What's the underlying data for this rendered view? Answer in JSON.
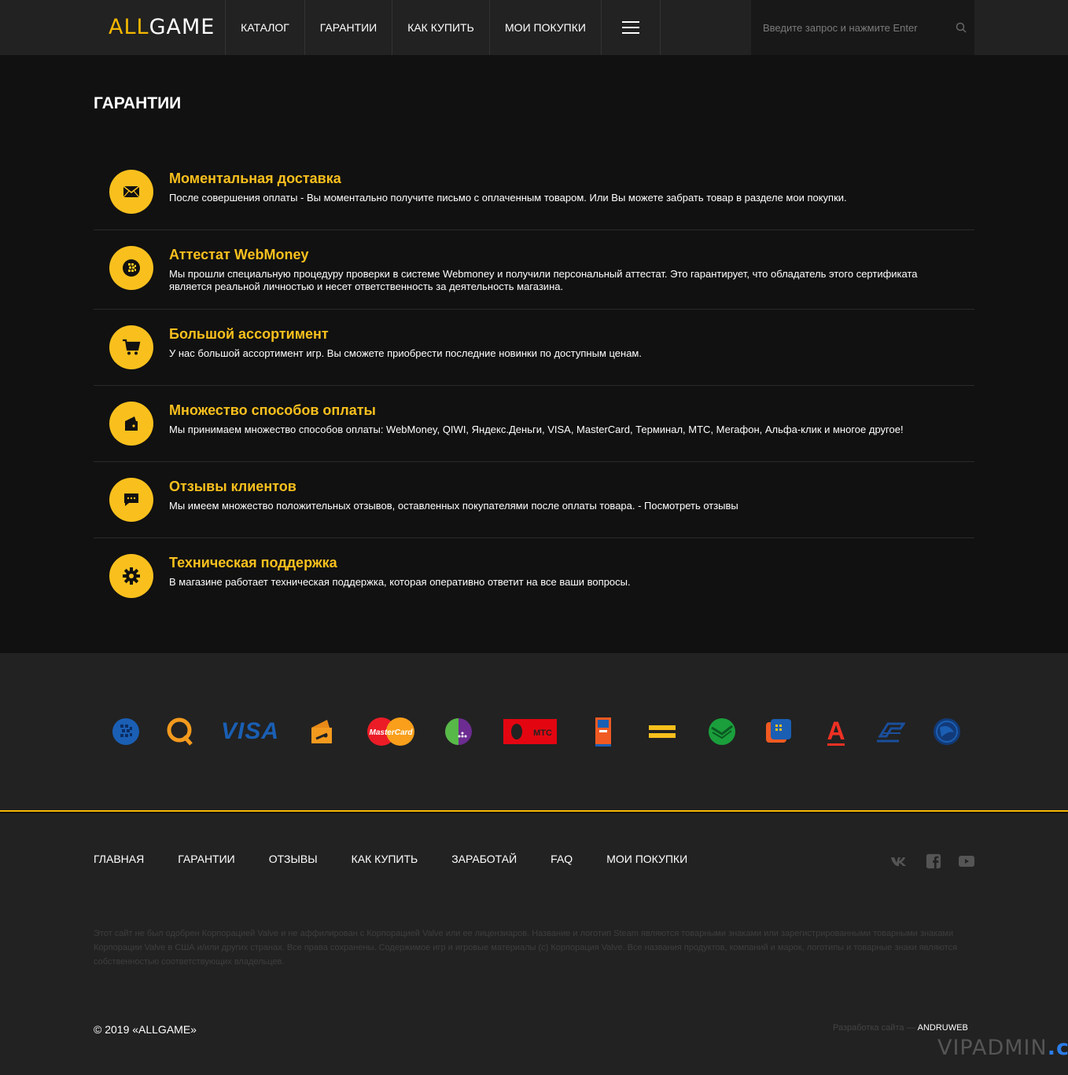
{
  "header": {
    "logo_part1": "ALL",
    "logo_part2": "GAME",
    "nav": [
      "КАТАЛОГ",
      "ГАРАНТИИ",
      "КАК КУПИТЬ",
      "МОИ ПОКУПКИ"
    ],
    "search_placeholder": "Введите запрос и нажмите Enter"
  },
  "main": {
    "title": "ГАРАНТИИ",
    "features": [
      {
        "icon": "envelope-icon",
        "title": "Моментальная доставка",
        "text": "После совершения оплаты - Вы моментально получите письмо с оплаченным товаром. Или Вы можете забрать товар в разделе мои покупки."
      },
      {
        "icon": "webmoney-globe-icon",
        "title": "Аттестат WebMoney",
        "text": "Мы прошли специальную процедуру проверки в системе Webmoney и получили персональный аттестат. Это гарантирует, что обладатель этого сертификата является реальной личностью и несет ответственность за деятельность магазина."
      },
      {
        "icon": "cart-icon",
        "title": "Большой ассортимент",
        "text": "У нас большой ассортимент игр. Вы сможете приобрести последние новинки по доступным ценам."
      },
      {
        "icon": "wallet-icon",
        "title": "Множество способов оплаты",
        "text": "Мы принимаем множество способов оплаты: WebMoney, QIWI, Яндекс.Деньги, VISA, MasterCard, Терминал, МТС, Мегафон, Альфа-клик и многое другое!"
      },
      {
        "icon": "chat-icon",
        "title": "Отзывы клиентов",
        "text": "Мы имеем множество положительных отзывов, оставленных покупателями после оплаты товара. - Посмотреть отзывы"
      },
      {
        "icon": "gear-icon",
        "title": "Техническая поддержка",
        "text": "В магазине работает техническая поддержка, которая оперативно ответит на все ваши вопросы."
      }
    ]
  },
  "payments": {
    "visa_label": "VISA",
    "mastercard_label": "MasterCard",
    "mts_label": "МТС",
    "alfa_label": "А",
    "icons": [
      "webmoney-icon",
      "qiwi-icon",
      "visa-icon",
      "yandex-money-icon",
      "mastercard-icon",
      "megafon-icon",
      "mts-icon",
      "terminal-icon",
      "beeline-icon",
      "sberbank-icon",
      "rapida-icon",
      "alfa-bank-icon",
      "psb-icon",
      "liqpay-icon"
    ]
  },
  "footer": {
    "nav": [
      "ГЛАВНАЯ",
      "ГАРАНТИИ",
      "ОТЗЫВЫ",
      "КАК КУПИТЬ",
      "ЗАРАБОТАЙ",
      "FAQ",
      "МОИ ПОКУПКИ"
    ],
    "disclaimer": "Этот сайт не был одобрен Корпорацией Valve и не аффилирован с Корпорацией Valve или ее лицензиаров. Название и логотип Steam являются товарными знаками или зарегистрированными товарными знаками Корпорации Valve в США и/или других странах. Все права сохранены. Содержимое игр и игровые материалы (c) Корпорация Valve. Все названия продуктов, компаний и марок, логотипы и товарные знаки являются собственностью соответствующих владельцев.",
    "copyright": "© 2019 «ALLGAME»",
    "dev_label": "Разработка сайта —",
    "dev_name": "ANDRUWEB"
  },
  "watermark": {
    "part1": "VIPADMIN",
    "part2": ".club"
  },
  "colors": {
    "accent": "#f9c01d",
    "header_bg": "#222222",
    "page_bg": "#111111"
  }
}
